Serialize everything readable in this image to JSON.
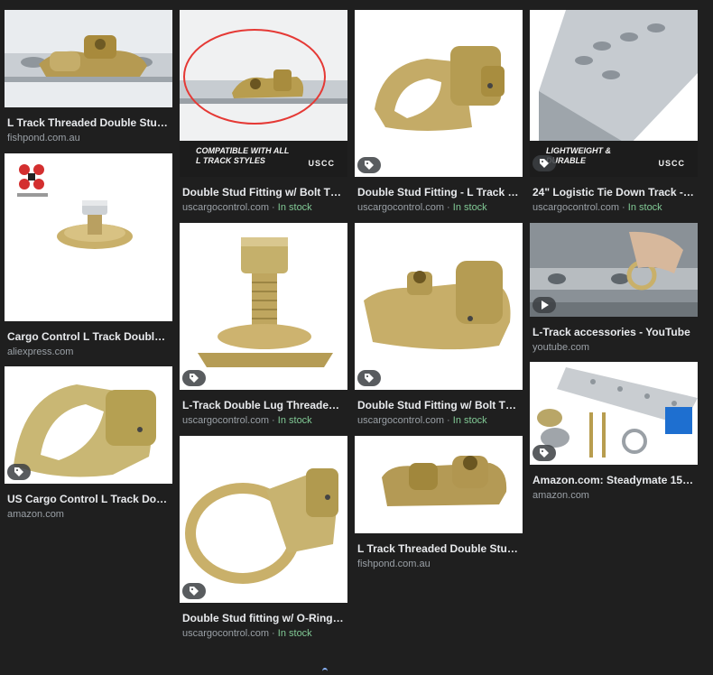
{
  "results": [
    {
      "title": "L Track Threaded Double Stud ...",
      "source": "fishpond.com.au",
      "in_stock": ""
    },
    {
      "title": "Cargo Control L Track Double ...",
      "source": "aliexpress.com",
      "in_stock": ""
    },
    {
      "title": "US Cargo Control L Track Dou...",
      "source": "amazon.com",
      "in_stock": ""
    },
    {
      "title": "Double Stud Fitting w/ Bolt Thr...",
      "source": "uscargocontrol.com",
      "in_stock": "In stock",
      "banner": "Compatible with all L Track styles",
      "banner_logo": "USCC"
    },
    {
      "title": "L-Track Double Lug Threaded ...",
      "source": "uscargocontrol.com",
      "in_stock": "In stock"
    },
    {
      "title": "Double Stud fitting w/ O-Ring - ...",
      "source": "uscargocontrol.com",
      "in_stock": "In stock"
    },
    {
      "title": "Double Stud Fitting - L Track Fi...",
      "source": "uscargocontrol.com",
      "in_stock": "In stock"
    },
    {
      "title": "Double Stud Fitting w/ Bolt Thr...",
      "source": "uscargocontrol.com",
      "in_stock": "In stock"
    },
    {
      "title": "L Track Threaded Double Stud ...",
      "source": "fishpond.com.au",
      "in_stock": ""
    },
    {
      "title": "24\" Logistic Tie Down Track - L...",
      "source": "uscargocontrol.com",
      "in_stock": "In stock",
      "banner": "Lightweight & Durable",
      "banner_logo": "USCC"
    },
    {
      "title": "L-Track accessories - YouTube",
      "source": "youtube.com",
      "in_stock": ""
    },
    {
      "title": "Amazon.com: Steadymate 155...",
      "source": "amazon.com",
      "in_stock": ""
    }
  ],
  "colors": {
    "background": "#1f1f1f",
    "title": "#e8eaed",
    "source": "#9aa0a6",
    "in_stock": "#81c995",
    "annotation_circle": "#e53935"
  },
  "icons": {
    "product_tag": "tag-icon",
    "video": "play-icon",
    "loading": "spinner-icon"
  }
}
